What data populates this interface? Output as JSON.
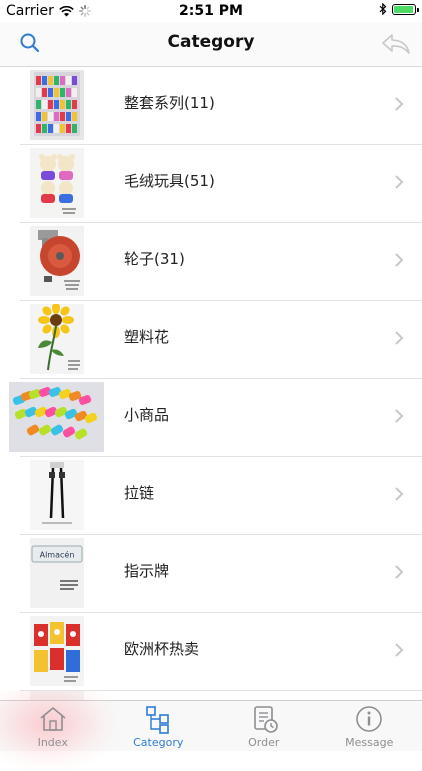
{
  "status_bar": {
    "carrier": "Carrier",
    "time": "2:51 PM"
  },
  "nav": {
    "title": "Category"
  },
  "categories": [
    {
      "label": "整套系列(11)",
      "thumb": "rack-display"
    },
    {
      "label": "毛绒玩具(51)",
      "thumb": "plush-bears"
    },
    {
      "label": "轮子(31)",
      "thumb": "caster-wheel"
    },
    {
      "label": "塑料花",
      "thumb": "sunflower"
    },
    {
      "label": "小商品",
      "thumb": "colorful-toys"
    },
    {
      "label": "拉链",
      "thumb": "zippers"
    },
    {
      "label": "指示牌",
      "thumb": "sign-plate"
    },
    {
      "label": "欧洲杯热卖",
      "thumb": "football-cards"
    }
  ],
  "tabs": [
    {
      "label": "Index",
      "icon": "home-icon"
    },
    {
      "label": "Category",
      "icon": "category-icon"
    },
    {
      "label": "Order",
      "icon": "order-icon"
    },
    {
      "label": "Message",
      "icon": "info-icon"
    }
  ],
  "colors": {
    "accent": "#2e7bd6",
    "inactive": "#8e8e93",
    "battery": "#4cd964"
  },
  "sign_text": "Almacén"
}
